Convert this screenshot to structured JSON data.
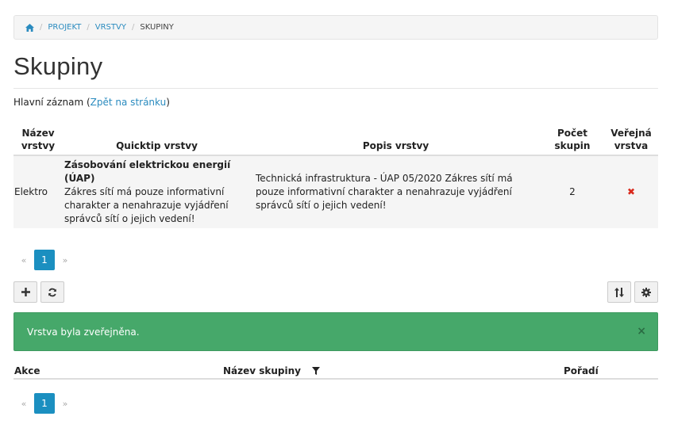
{
  "breadcrumb": {
    "items": [
      "Projekt",
      "Vrstvy"
    ],
    "current": "Skupiny"
  },
  "page": {
    "title": "Skupiny",
    "master_label": "Hlavní záznam (",
    "master_link": "Zpět na stránku",
    "master_end": ")"
  },
  "layers_table": {
    "headers": {
      "name": "Název vrstvy",
      "quicktip": "Quicktip vrstvy",
      "description": "Popis vrstvy",
      "group_count": "Počet skupin",
      "public": "Veřejná vrstva"
    },
    "rows": [
      {
        "name": "Elektro",
        "quicktip_title": "Zásobování elektrickou energií (ÚAP)",
        "quicktip_text": "Zákres sítí má pouze informativní charakter a nenahrazuje vyjádření správců sítí o jejich vedení!",
        "description": "Technická infrastruktura - ÚAP 05/2020 Zákres sítí má pouze informativní charakter a nenahrazuje vyjádření správců sítí o jejich vedení!",
        "group_count": "2",
        "public": "✖",
        "public_value": false
      }
    ]
  },
  "pagination_top": {
    "prev": "«",
    "page": "1",
    "next": "»"
  },
  "pagination_bottom": {
    "prev": "«",
    "page": "1",
    "next": "»"
  },
  "toolbar": {
    "add_icon": "plus-icon",
    "refresh_icon": "refresh-icon",
    "sort_icon": "sort-icon",
    "settings_icon": "gear-icon"
  },
  "alert": {
    "message": "Vrstva byla zveřejněna.",
    "close": "×",
    "color": "#46a86a"
  },
  "groups_table": {
    "headers": {
      "actions": "Akce",
      "group_name": "Název skupiny",
      "order": "Pořadí"
    }
  },
  "colors": {
    "accent": "#1b8fc0",
    "link": "#2a8bbf",
    "danger": "#d9291c"
  }
}
